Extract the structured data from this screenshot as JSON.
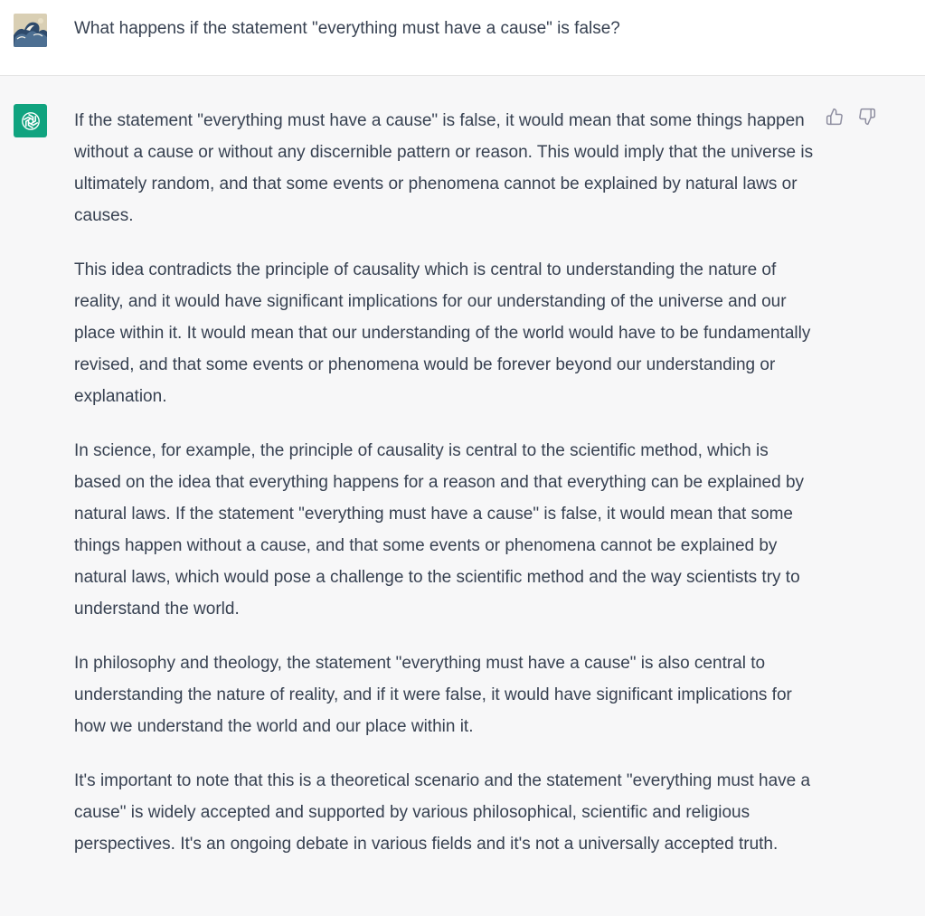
{
  "user_message": {
    "text": "What happens if the statement \"everything must have a cause\" is false?"
  },
  "assistant_message": {
    "paragraphs": [
      "If the statement \"everything must have a cause\" is false, it would mean that some things happen without a cause or without any discernible pattern or reason. This would imply that the universe is ultimately random, and that some events or phenomena cannot be explained by natural laws or causes.",
      "This idea contradicts the principle of causality which is central to understanding the nature of reality, and it would have significant implications for our understanding of the universe and our place within it. It would mean that our understanding of the world would have to be fundamentally revised, and that some events or phenomena would be forever beyond our understanding or explanation.",
      "In science, for example, the principle of causality is central to the scientific method, which is based on the idea that everything happens for a reason and that everything can be explained by natural laws. If the statement \"everything must have a cause\" is false, it would mean that some things happen without a cause, and that some events or phenomena cannot be explained by natural laws, which would pose a challenge to the scientific method and the way scientists try to understand the world.",
      "In philosophy and theology, the statement \"everything must have a cause\" is also central to understanding the nature of reality, and if it were false, it would have significant implications for how we understand the world and our place within it.",
      "It's important to note that this is a theoretical scenario and the statement \"everything must have a cause\" is widely accepted and supported by various philosophical, scientific and religious perspectives. It's an ongoing debate in various fields and it's not a universally accepted truth."
    ]
  },
  "icons": {
    "user_avatar": "wave-painting-avatar-icon",
    "assistant_avatar": "openai-logo-icon",
    "thumbs_up": "thumbs-up-icon",
    "thumbs_down": "thumbs-down-icon"
  },
  "colors": {
    "assistant_avatar_bg": "#10a37f",
    "text": "#374151",
    "assistant_row_bg": "#f7f7f8",
    "user_row_bg": "#ffffff"
  }
}
